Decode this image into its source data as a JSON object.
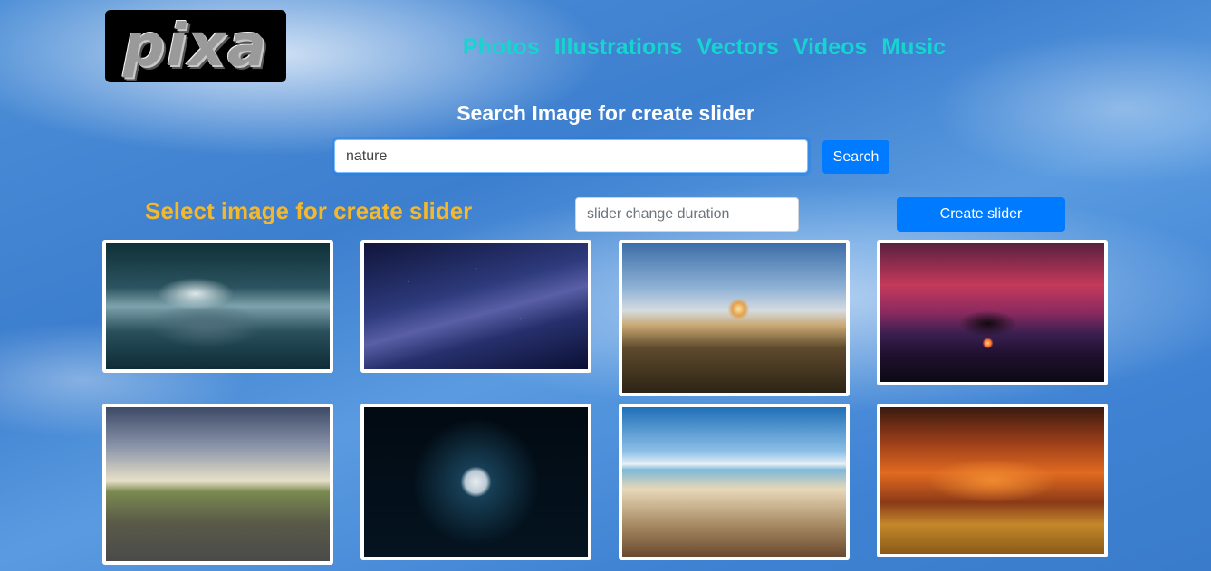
{
  "logo": {
    "text": "pixa"
  },
  "nav": {
    "items": [
      "Photos",
      "Illustrations",
      "Vectors",
      "Videos",
      "Music"
    ]
  },
  "search": {
    "title": "Search Image for create slider",
    "value": "nature",
    "button_label": "Search"
  },
  "slider": {
    "title": "Select image for create slider",
    "duration_placeholder": "slider change duration",
    "create_label": "Create slider"
  },
  "images": [
    {
      "subject": "storm-clouds"
    },
    {
      "subject": "milky-way"
    },
    {
      "subject": "mountain-sunset"
    },
    {
      "subject": "tree-red-sky"
    },
    {
      "subject": "country-road"
    },
    {
      "subject": "full-moon"
    },
    {
      "subject": "pier-sea"
    },
    {
      "subject": "orange-sky-field"
    }
  ],
  "colors": {
    "nav": "#17d4cf",
    "select_title": "#f3b82e",
    "primary_button": "#007bff"
  }
}
